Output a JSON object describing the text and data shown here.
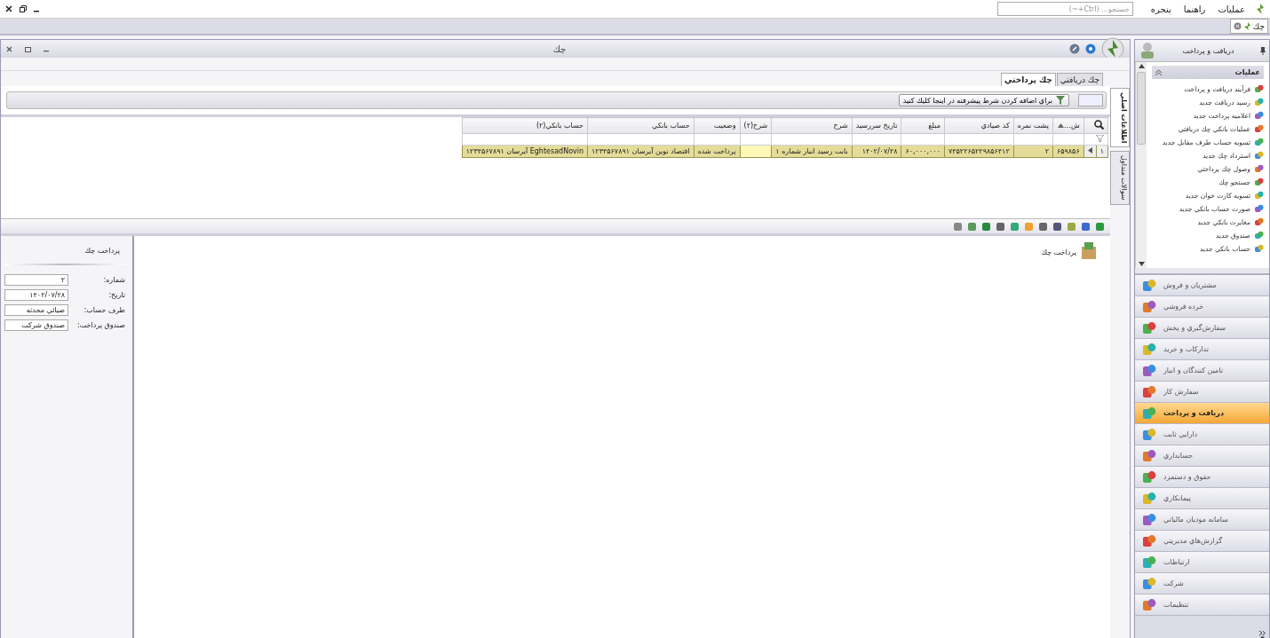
{
  "menubar": {
    "menus": [
      "عمليات",
      "راهنما",
      "پنجره"
    ],
    "search": {
      "placeholder": "جستجو... (Ctrl+~)"
    }
  },
  "document_tabs": [
    {
      "label": "چك",
      "selected": true
    }
  ],
  "window": {
    "title": "چك"
  },
  "tabs": [
    {
      "label": "چك دريافتي",
      "selected": false
    },
    {
      "label": "چك پرداختي",
      "selected": true
    }
  ],
  "filter_button": "براي اضافه كردن شرط پيشرفته در اينجا كليك كنيد",
  "side_tabs": [
    {
      "label": "اطلاعات اصلي",
      "selected": true
    },
    {
      "label": "سوالات متداول",
      "selected": false
    }
  ],
  "table": {
    "columns": [
      "ش...",
      "پشت نمره",
      "كد صيادي",
      "مبلغ",
      "تاريخ سررسيد",
      "شرح",
      "شرح(۲)",
      "وضعيت",
      "حساب بانكي",
      "حساب بانكي(۲)"
    ],
    "rows": [
      {
        "row_number": "۱",
        "selected": true,
        "cells": [
          "۶۵۹۸۵۶",
          "۲",
          "۷۴۵۲۲۶۵۲۲۹۸۵۶۴۱۲",
          "۶۰,۰۰۰,۰۰۰",
          "۱۴۰۲/۰۷/۲۸",
          "بابت رسيد انبار شماره ۱",
          null,
          "پرداخت شده",
          "اقتصاد نوين آيرسان ۱۲۳۴۵۶۷۸۹۱",
          "EghtesadNovin آيرسان ۱۲۳۴۵۶۷۸۹۱"
        ]
      }
    ]
  },
  "detail": {
    "title": "پرداخت چك",
    "fields": [
      {
        "label": "شماره:",
        "value": "۲"
      },
      {
        "label": "تاريخ:",
        "value": "۱۴۰۲/۰۷/۲۸"
      },
      {
        "label": "طرف حساب:",
        "value": "ضيائي محدثه"
      },
      {
        "label": "صندوق پرداخت:",
        "value": "صندوق شركت"
      }
    ]
  },
  "document": {
    "title": "پرداخت چك"
  },
  "sidebar": {
    "title": "دريافت و پرداخت",
    "section": {
      "title": "عمليات",
      "expanded": true,
      "items": [
        "فرآيند دريافت و پرداخت",
        "رسيد دريافت جديد",
        "اعلاميه پرداخت جديد",
        "عمليات بانكي چك دريافتي",
        "تسويه حساب طرف مقابل جديد",
        "استرداد چك جديد",
        "وصول چك پرداختي",
        "جستجو چك",
        "تسويه كارت خوان جديد",
        "صورت حساب بانكي جديد",
        "مغايرت بانكي جديد",
        "صندوق جديد",
        "حساب بانكي جديد"
      ]
    },
    "modules": [
      {
        "label": "مشتريان و فروش",
        "selected": false
      },
      {
        "label": "خرده فروشي",
        "selected": false
      },
      {
        "label": "سفارش‌گيري و پخش",
        "selected": false
      },
      {
        "label": "تداركات و خريد",
        "selected": false
      },
      {
        "label": "تامين كنندگان و انبار",
        "selected": false
      },
      {
        "label": "سفارش كار",
        "selected": false
      },
      {
        "label": "دريافت و پرداخت",
        "selected": true
      },
      {
        "label": "دارايي ثابت",
        "selected": false
      },
      {
        "label": "حسابداري",
        "selected": false
      },
      {
        "label": "حقوق و دستمزد",
        "selected": false
      },
      {
        "label": "پيمانكاري",
        "selected": false
      },
      {
        "label": "سامانه موديان مالياتي",
        "selected": false
      },
      {
        "label": "گزارش‌هاي مديريتي",
        "selected": false
      },
      {
        "label": "ارتباطات",
        "selected": false
      },
      {
        "label": "شركت",
        "selected": false
      },
      {
        "label": "تنظيمات",
        "selected": false
      }
    ]
  }
}
